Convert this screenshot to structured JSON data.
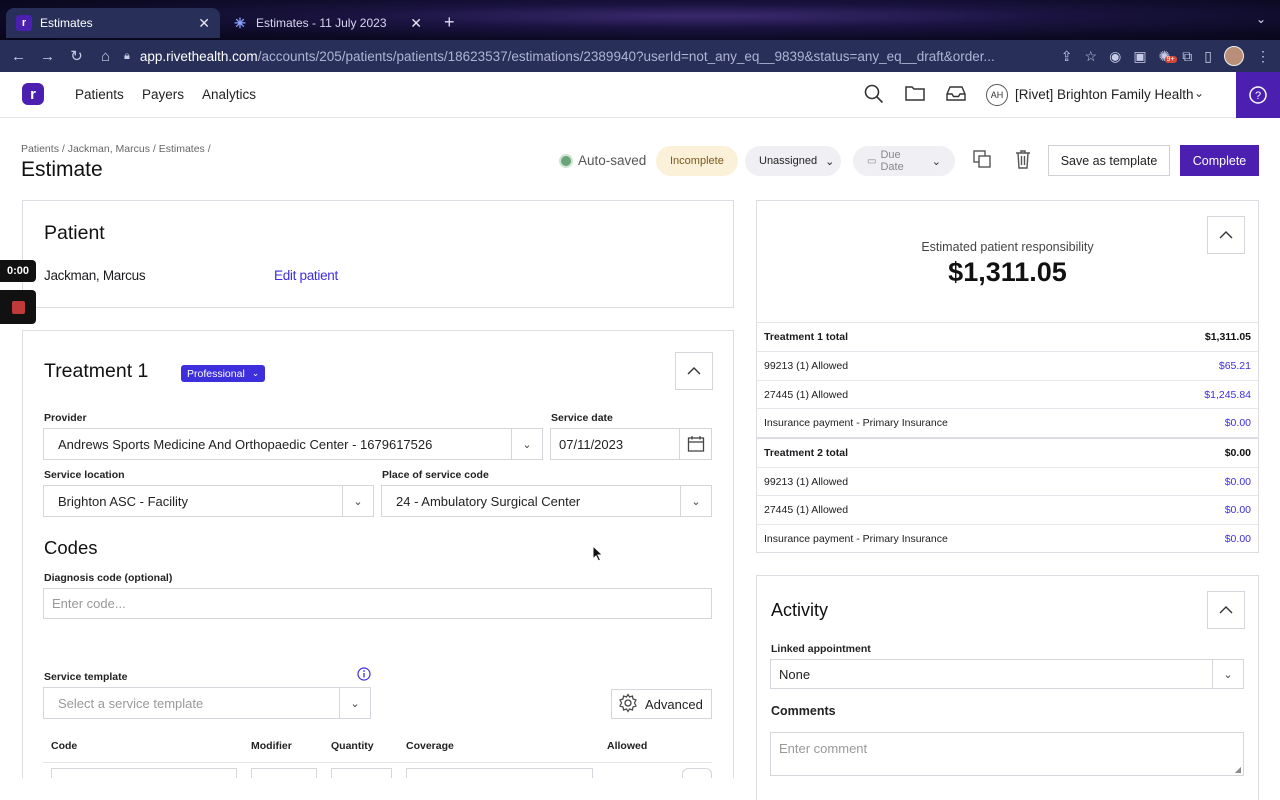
{
  "browser": {
    "tabs": [
      {
        "label": "Estimates",
        "active": true
      },
      {
        "label": "Estimates - 11 July 2023",
        "active": false
      }
    ],
    "url_host": "app.rivethealth.com",
    "url_path": "/accounts/205/patients/patients/18623537/estimations/2389940?userId=not_any_eq__9839&status=any_eq__draft&order...",
    "badge": "9+"
  },
  "nav": {
    "logo": "r",
    "links": [
      "Patients",
      "Payers",
      "Analytics"
    ],
    "org_initials": "AH",
    "org_name": "[Rivet] Brighton Family Health"
  },
  "header": {
    "breadcrumb": "Patients / Jackman, Marcus / Estimates /",
    "title": "Estimate",
    "autosave": "Auto-saved",
    "status": "Incomplete",
    "assignee": "Unassigned",
    "due_date_placeholder": "Due Date",
    "save_template": "Save as template",
    "complete": "Complete"
  },
  "patient": {
    "heading": "Patient",
    "name": "Jackman, Marcus",
    "edit": "Edit patient"
  },
  "treatment": {
    "heading": "Treatment 1",
    "type": "Professional",
    "provider_label": "Provider",
    "provider_value": "Andrews Sports Medicine And Orthopaedic Center - 1679617526",
    "service_date_label": "Service date",
    "service_date_value": "07/11/2023",
    "location_label": "Service location",
    "location_value": "Brighton ASC - Facility",
    "pos_label": "Place of service code",
    "pos_value": "24 - Ambulatory Surgical Center",
    "codes_heading": "Codes",
    "diagnosis_label": "Diagnosis code (optional)",
    "diagnosis_placeholder": "Enter code...",
    "template_label": "Service template",
    "template_placeholder": "Select a service template",
    "advanced": "Advanced",
    "columns": [
      "Code",
      "Modifier",
      "Quantity",
      "Coverage",
      "Allowed"
    ]
  },
  "summary": {
    "label": "Estimated patient responsibility",
    "amount": "$1,311.05",
    "rows": [
      {
        "label": "Treatment 1 total",
        "value": "$1,311.05",
        "total": true
      },
      {
        "label": "99213 (1) Allowed",
        "value": "$65.21",
        "total": false
      },
      {
        "label": "27445 (1) Allowed",
        "value": "$1,245.84",
        "total": false
      },
      {
        "label": "Insurance payment - Primary Insurance",
        "value": "$0.00",
        "total": false
      },
      {
        "label": "Treatment 2 total",
        "value": "$0.00",
        "total": true
      },
      {
        "label": "99213 (1) Allowed",
        "value": "$0.00",
        "total": false
      },
      {
        "label": "27445 (1) Allowed",
        "value": "$0.00",
        "total": false
      },
      {
        "label": "Insurance payment - Primary Insurance",
        "value": "$0.00",
        "total": false
      }
    ]
  },
  "activity": {
    "heading": "Activity",
    "appointment_label": "Linked appointment",
    "appointment_value": "None",
    "comments_label": "Comments",
    "comments_placeholder": "Enter comment"
  },
  "recorder": {
    "time": "0:00"
  },
  "colors": {
    "brand": "#4b1fb0",
    "link": "#3d2fdc",
    "autosave": "#6aa57a"
  }
}
